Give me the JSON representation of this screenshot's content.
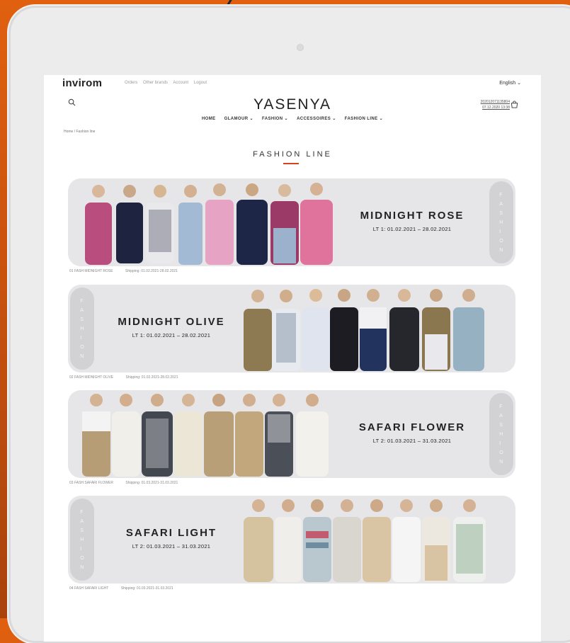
{
  "logo": "invirom",
  "top_links": [
    "Orders",
    "Other brands",
    "Account",
    "Logout"
  ],
  "language": "English ⌄",
  "brand": "YASENYA",
  "order_info": [
    "202012071135804",
    "07.12.2020 13:38"
  ],
  "nav": [
    "HOME",
    "GLAMOUR ⌄",
    "FASHION ⌄",
    "ACCESSOIRES ⌄",
    "FASHION LINE ⌄"
  ],
  "breadcrumb": "Home  /  Fashion line",
  "section_title": "FASHION LINE",
  "vtab_text": "FASHION",
  "banners": [
    {
      "name": "MIDNIGHT ROSE",
      "dates": "LT 1: 01.02.2021 – 28.02.2021",
      "caption_code": "01 FASH MIDNIGHT ROSE",
      "caption_shipping": "Shipping: 01.02.2021-28.02.2021"
    },
    {
      "name": "MIDNIGHT OLIVE",
      "dates": "LT 1: 01.02.2021 – 28.02.2021",
      "caption_code": "02 FASH MIDNIGHT OLIVE",
      "caption_shipping": "Shipping: 01.02.2021-28.02.2021"
    },
    {
      "name": "SAFARI FLOWER",
      "dates": "LT 2: 01.03.2021 – 31.03.2021",
      "caption_code": "03 FASH SAFARI FLOWER",
      "caption_shipping": "Shipping: 01.03.2021-31.03.2021"
    },
    {
      "name": "SAFARI LIGHT",
      "dates": "LT 2: 01.03.2021 – 31.03.2021",
      "caption_code": "04 FASH SAFARI LIGHT",
      "caption_shipping": "Shipping: 01.03.2021-31.03.2021"
    }
  ],
  "icons": {
    "search": "search-icon",
    "cart": "shopping-bag-icon",
    "arrow": "arrow-icon"
  },
  "colors": {
    "background": "#d9580e",
    "accent": "#d4421f",
    "banner": "#e6e6e8"
  }
}
